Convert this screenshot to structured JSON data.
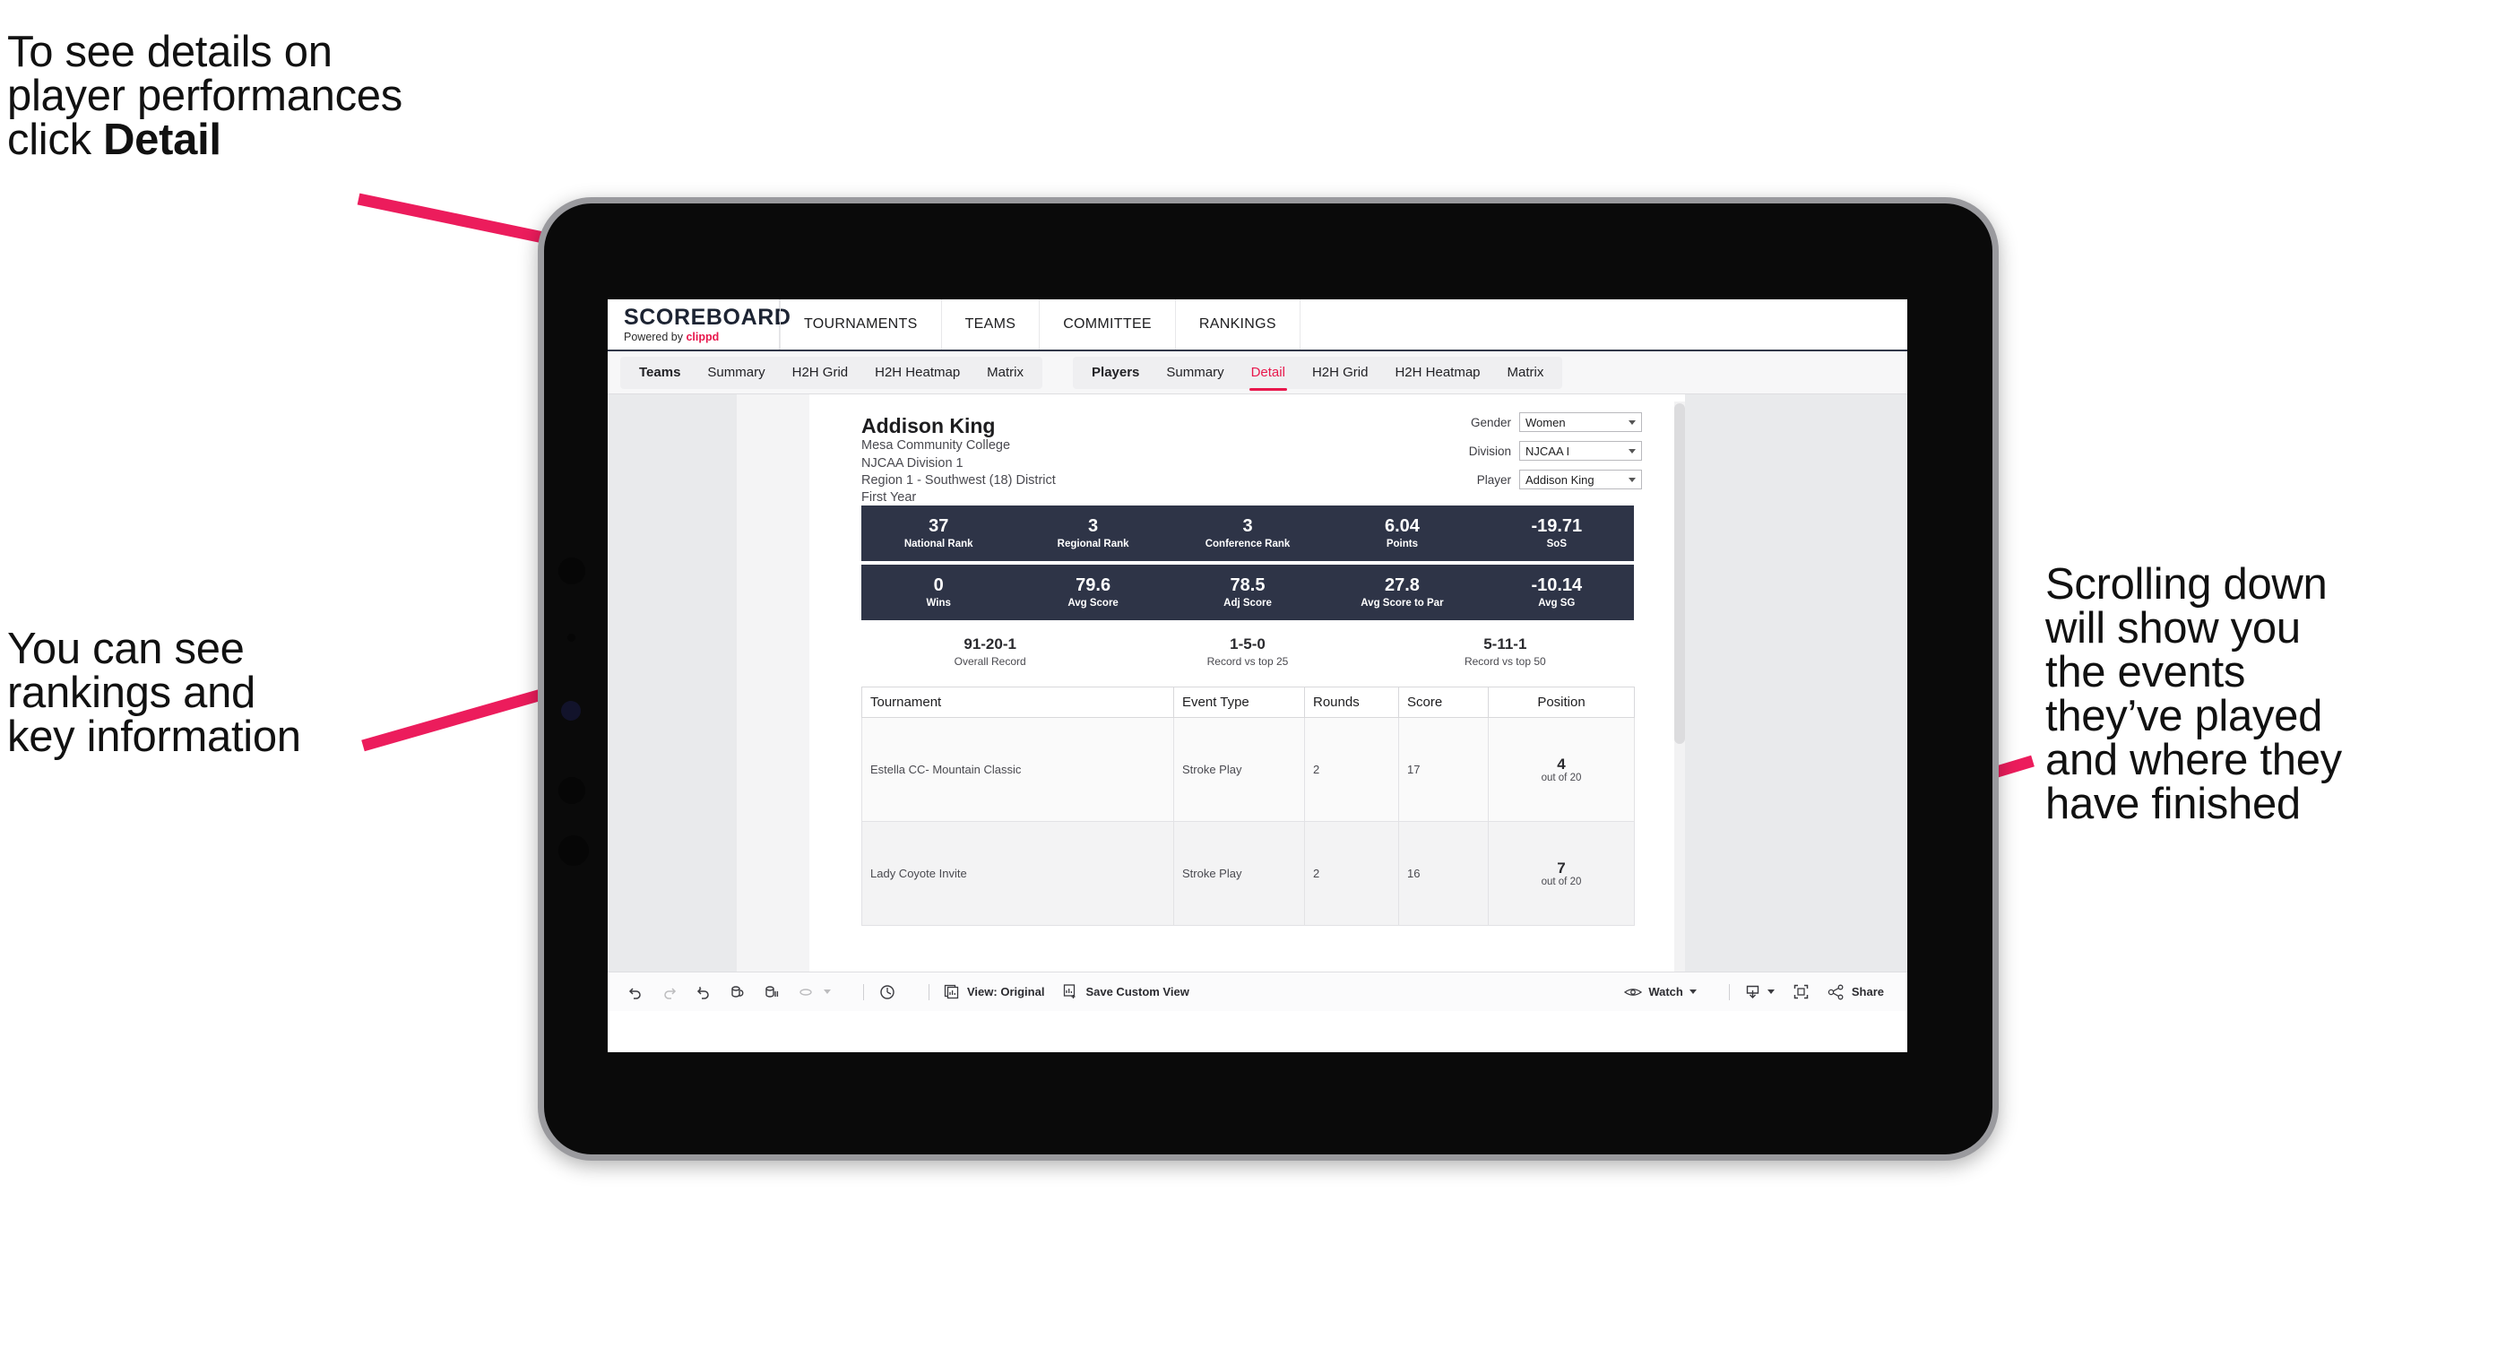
{
  "annotations": {
    "top": "To see details on\nplayer performances\nclick ",
    "top_bold": "Detail",
    "left": "You can see\nrankings and\nkey information",
    "right": "Scrolling down\nwill show you\nthe events\nthey’ve played\nand where they\nhave finished",
    "arrow_color": "#ec1c5c"
  },
  "app": {
    "logo": {
      "title": "SCOREBOARD",
      "powered_prefix": "Powered by ",
      "brand": "clippd"
    },
    "top_nav": [
      "TOURNAMENTS",
      "TEAMS",
      "COMMITTEE",
      "RANKINGS"
    ],
    "tab_groups": [
      {
        "lead": "Teams",
        "tabs": [
          "Summary",
          "H2H Grid",
          "H2H Heatmap",
          "Matrix"
        ],
        "active": ""
      },
      {
        "lead": "Players",
        "tabs": [
          "Summary",
          "Detail",
          "H2H Grid",
          "H2H Heatmap",
          "Matrix"
        ],
        "active": "Detail"
      }
    ],
    "accent": "#e8174c"
  },
  "player": {
    "name": "Addison King",
    "meta": [
      "Mesa Community College",
      "NJCAA Division 1",
      "Region 1 - Southwest (18) District",
      "First Year"
    ]
  },
  "selectors": [
    {
      "label": "Gender",
      "value": "Women"
    },
    {
      "label": "Division",
      "value": "NJCAA I"
    },
    {
      "label": "Player",
      "value": "Addison King"
    }
  ],
  "stat_bands": [
    {
      "bg": "#2e3447",
      "cells": [
        {
          "value": "37",
          "label": "National Rank"
        },
        {
          "value": "3",
          "label": "Regional Rank"
        },
        {
          "value": "3",
          "label": "Conference Rank"
        },
        {
          "value": "6.04",
          "label": "Points"
        },
        {
          "value": "-19.71",
          "label": "SoS"
        }
      ]
    },
    {
      "bg": "#2e3447",
      "cells": [
        {
          "value": "0",
          "label": "Wins"
        },
        {
          "value": "79.6",
          "label": "Avg Score"
        },
        {
          "value": "78.5",
          "label": "Adj Score"
        },
        {
          "value": "27.8",
          "label": "Avg Score to Par"
        },
        {
          "value": "-10.14",
          "label": "Avg SG"
        }
      ]
    }
  ],
  "records": [
    {
      "value": "91-20-1",
      "label": "Overall Record"
    },
    {
      "value": "1-5-0",
      "label": "Record vs top 25"
    },
    {
      "value": "5-11-1",
      "label": "Record vs top 50"
    }
  ],
  "tournament_table": {
    "columns": [
      "Tournament",
      "Event Type",
      "Rounds",
      "Score",
      "Position"
    ],
    "rows": [
      {
        "tournament": "Estella CC- Mountain Classic",
        "event_type": "Stroke Play",
        "rounds": "2",
        "score": "17",
        "position": "4",
        "position_sub": "out of 20"
      },
      {
        "tournament": "Lady Coyote Invite",
        "event_type": "Stroke Play",
        "rounds": "2",
        "score": "16",
        "position": "7",
        "position_sub": "out of 20"
      }
    ]
  },
  "toolbar": {
    "view_label": "View: Original",
    "save_label": "Save Custom View",
    "watch_label": "Watch",
    "share_label": "Share"
  }
}
